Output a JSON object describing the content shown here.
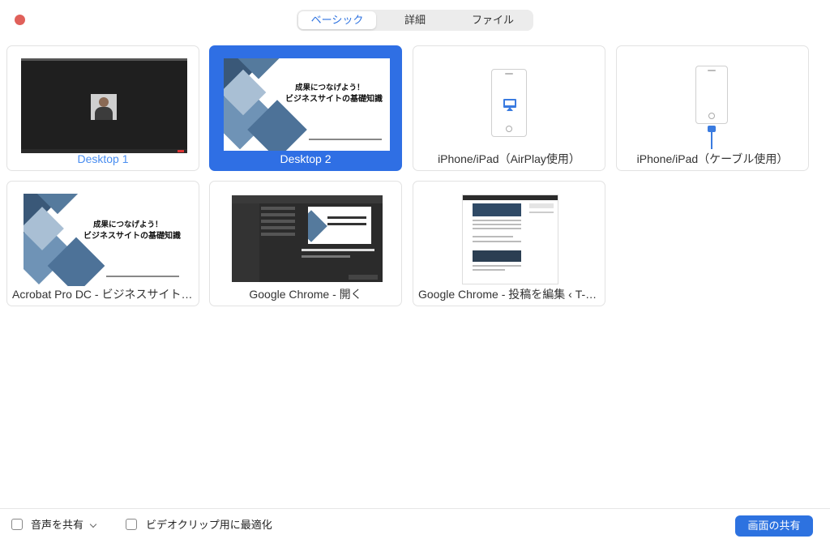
{
  "tabs": [
    "ベーシック",
    "詳細",
    "ファイル"
  ],
  "cards": [
    {
      "label": "Desktop 1"
    },
    {
      "label": "Desktop 2"
    },
    {
      "label": "iPhone/iPad（AirPlay使用）"
    },
    {
      "label": "iPhone/iPad（ケーブル使用）"
    },
    {
      "label": "Acrobat Pro DC - ビジネスサイトの…"
    },
    {
      "label": "Google Chrome - 開く"
    },
    {
      "label": "Google Chrome - 投稿を編集 ‹ T-ST…"
    }
  ],
  "slide": {
    "title1": "成果につなげよう！",
    "title2": "ビジネスサイトの基礎知識"
  },
  "footer": {
    "share_audio": "音声を共有",
    "optimize_video": "ビデオクリップ用に最適化",
    "share_button": "画面の共有"
  },
  "colors": {
    "accent": "#2d72e0",
    "selected_card": "#2f6fe4",
    "close_dot": "#e0605a"
  }
}
